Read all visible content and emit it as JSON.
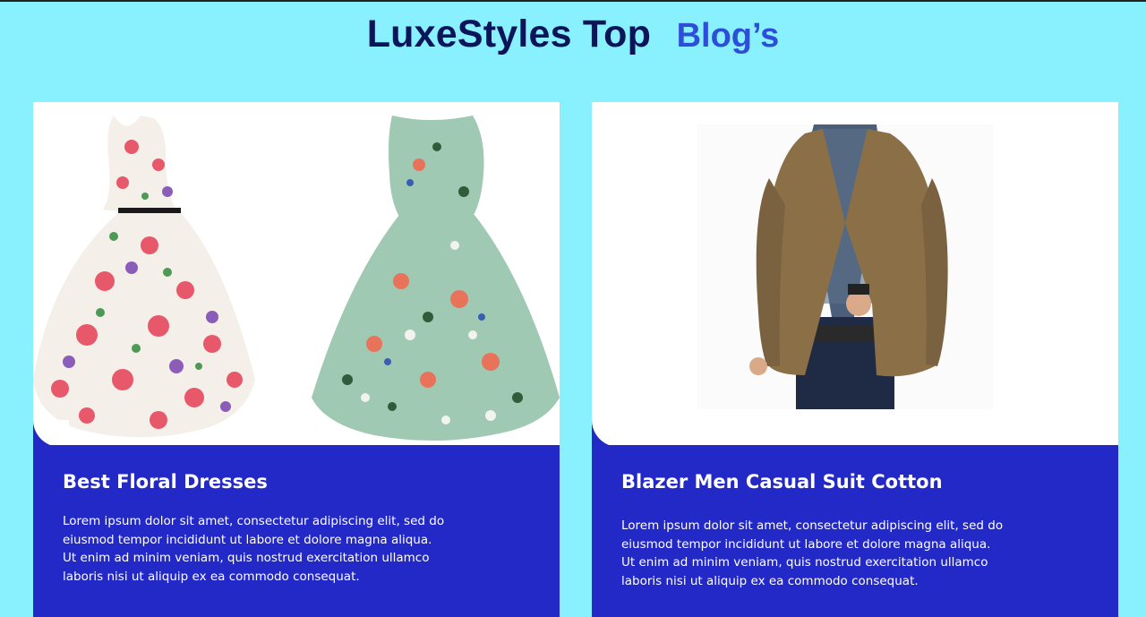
{
  "header": {
    "title_main": "LuxeStyles Top",
    "title_accent": "Blog’s"
  },
  "colors": {
    "background": "#88F1FD",
    "header_dark": "#0C1559",
    "header_accent": "#2D4FD8",
    "card_info_bg": "#2329C7",
    "card_bg": "#FFFFFF"
  },
  "cards": [
    {
      "title": "Best Floral Dresses",
      "text": "Lorem ipsum dolor sit amet, consectetur adipiscing elit, sed do eiusmod tempor incididunt ut labore et dolore magna aliqua. Ut enim ad minim veniam, quis nostrud exercitation ullamco laboris nisi ut aliquip ex ea commodo consequat.",
      "images": [
        "floral-dress-cream-image",
        "floral-dress-mint-image"
      ]
    },
    {
      "title": "Blazer Men Casual Suit Cotton",
      "text": "Lorem ipsum dolor sit amet, consectetur adipiscing elit, sed do eiusmod tempor incididunt ut labore et dolore magna aliqua. Ut enim ad minim veniam, quis nostrud exercitation ullamco laboris nisi ut aliquip ex ea commodo consequat.",
      "images": [
        "men-blazer-image"
      ]
    }
  ]
}
